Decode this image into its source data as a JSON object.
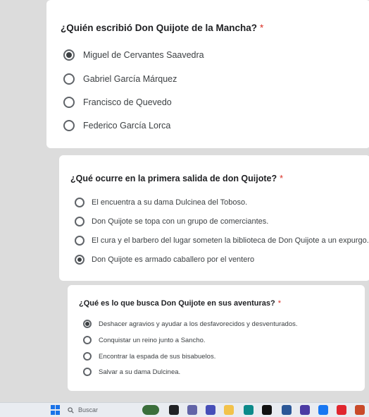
{
  "questions": [
    {
      "text": "¿Quién escribió Don Quijote de la Mancha?",
      "required_mark": "*",
      "options": [
        {
          "label": "Miguel de Cervantes Saavedra",
          "selected": true
        },
        {
          "label": "Gabriel García Márquez",
          "selected": false
        },
        {
          "label": "Francisco de Quevedo",
          "selected": false
        },
        {
          "label": "Federico García Lorca",
          "selected": false
        }
      ]
    },
    {
      "text": "¿Qué ocurre en la primera salida de don Quijote?",
      "required_mark": "*",
      "options": [
        {
          "label": "El encuentra a su dama Dulcinea del Toboso.",
          "selected": false
        },
        {
          "label": "Don Quijote se topa con un grupo de comerciantes.",
          "selected": false
        },
        {
          "label": "El cura y el barbero del lugar someten la biblioteca de Don Quijote a un expurgo.",
          "selected": false
        },
        {
          "label": "Don Quijote es armado caballero por el ventero",
          "selected": true
        }
      ]
    },
    {
      "text": "¿Qué es lo que busca Don Quijote en sus aventuras?",
      "required_mark": "*",
      "options": [
        {
          "label": "Deshacer agravios y ayudar a los desfavorecidos y desventurados.",
          "selected": true
        },
        {
          "label": "Conquistar un reino junto a Sancho.",
          "selected": false
        },
        {
          "label": "Encontrar la espada de sus bisabuelos.",
          "selected": false
        },
        {
          "label": "Salvar a su dama Dulcinea.",
          "selected": false
        }
      ]
    }
  ],
  "taskbar": {
    "search_placeholder": "Buscar",
    "apps": [
      {
        "icon": "weather-widget-icon",
        "color": "#3b6e3b"
      },
      {
        "icon": "task-view-icon",
        "color": "#202124"
      },
      {
        "icon": "chat-icon",
        "color": "#6264a7"
      },
      {
        "icon": "teams-icon",
        "color": "#464eb8"
      },
      {
        "icon": "file-explorer-icon",
        "color": "#f2c24b"
      },
      {
        "icon": "edge-icon",
        "color": "#0c8a8a"
      },
      {
        "icon": "tiktok-icon",
        "color": "#111111"
      },
      {
        "icon": "store-icon",
        "color": "#2b5797"
      },
      {
        "icon": "app-icon",
        "color": "#4b3aa3"
      },
      {
        "icon": "facebook-icon",
        "color": "#1877f2"
      },
      {
        "icon": "opera-icon",
        "color": "#e0262f"
      },
      {
        "icon": "game-icon",
        "color": "#c94a2a"
      }
    ]
  }
}
